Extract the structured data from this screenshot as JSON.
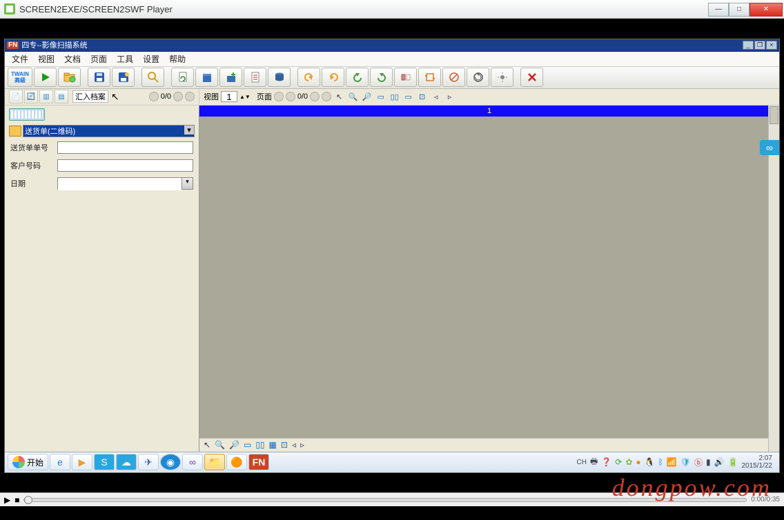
{
  "player": {
    "title": "SCREEN2EXE/SCREEN2SWF Player",
    "time": "0:00/0:35"
  },
  "app": {
    "logo": "FN",
    "title": "四专--影像扫描系统"
  },
  "menu": [
    "文件",
    "视图",
    "文档",
    "页面",
    "工具",
    "设置",
    "帮助"
  ],
  "toolbar": {
    "twain": "TWAIN\n高级"
  },
  "secondary": {
    "import_label": "汇入档案",
    "left_pager": "0/0",
    "view_label": "视图",
    "view_value": "1",
    "page_label": "页面",
    "page_count": "0/0"
  },
  "form": {
    "doc_type": "送货单(二维码)",
    "fields": [
      {
        "label": "送货单单号",
        "value": ""
      },
      {
        "label": "客户号码",
        "value": ""
      },
      {
        "label": "日期",
        "value": ""
      }
    ]
  },
  "canvas": {
    "header": "1"
  },
  "taskbar": {
    "start": "开始",
    "lang": "CH",
    "clock_time": "2:07",
    "clock_date": "2015/1/22"
  },
  "watermark": "dongpow.com"
}
